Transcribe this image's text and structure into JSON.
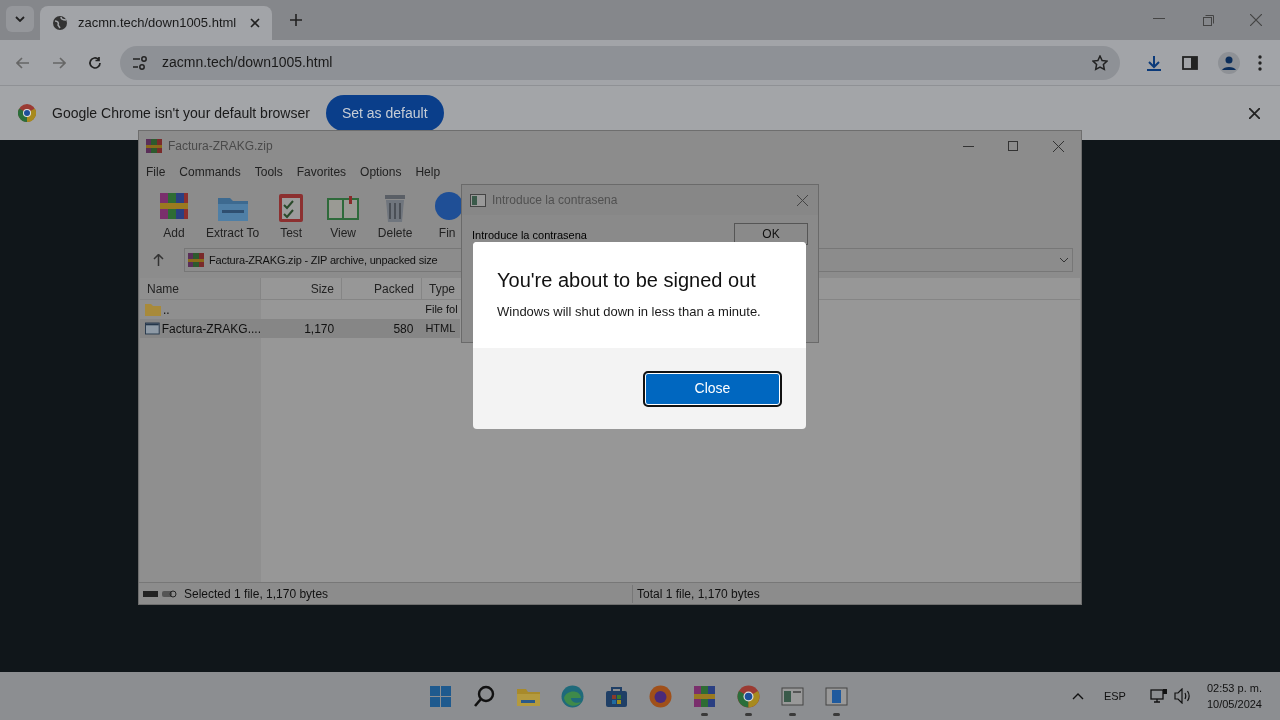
{
  "browser": {
    "tab": {
      "title": "zacmn.tech/down1005.html"
    },
    "address": "zacmn.tech/down1005.html",
    "infobar": {
      "message": "Google Chrome isn't your default browser",
      "button": "Set as default"
    }
  },
  "archiver": {
    "title": "Factura-ZRAKG.zip",
    "menu": [
      "File",
      "Commands",
      "Tools",
      "Favorites",
      "Options",
      "Help"
    ],
    "toolbar": [
      {
        "kind": "add",
        "label": "Add"
      },
      {
        "kind": "extract",
        "label": "Extract To"
      },
      {
        "kind": "test",
        "label": "Test"
      },
      {
        "kind": "view",
        "label": "View"
      },
      {
        "kind": "delete",
        "label": "Delete"
      },
      {
        "kind": "find",
        "label": "Fin"
      }
    ],
    "path": "Factura-ZRAKG.zip - ZIP archive, unpacked size",
    "columns": [
      "Name",
      "Size",
      "Packed",
      "Type"
    ],
    "rows": [
      {
        "kind": "folder",
        "name": "..",
        "size": "",
        "packed": "",
        "type": "File fol",
        "selected": false
      },
      {
        "kind": "file",
        "name": "Factura-ZRAKG....",
        "size": "1,170",
        "packed": "580",
        "type": "HTML",
        "selected": true
      }
    ],
    "status_left": "Selected 1 file, 1,170 bytes",
    "status_right": "Total 1 file, 1,170 bytes"
  },
  "password_dialog": {
    "title": "Introduce la contrasena",
    "label": "Introduce la contrasena",
    "ok": "OK"
  },
  "signout_dialog": {
    "title": "You're about to be signed out",
    "message": "Windows will shut down in less than a minute.",
    "button": "Close"
  },
  "taskbar": {
    "apps": [
      {
        "kind": "start",
        "running": false
      },
      {
        "kind": "search",
        "running": false
      },
      {
        "kind": "folder",
        "running": false
      },
      {
        "kind": "edge",
        "running": false
      },
      {
        "kind": "store",
        "running": false
      },
      {
        "kind": "firefox",
        "running": false
      },
      {
        "kind": "archiver",
        "running": true
      },
      {
        "kind": "chrome",
        "running": true
      },
      {
        "kind": "window",
        "running": true
      },
      {
        "kind": "window2",
        "running": true
      }
    ],
    "language": "ESP",
    "time": "02:53 p. m.",
    "date": "10/05/2024"
  }
}
